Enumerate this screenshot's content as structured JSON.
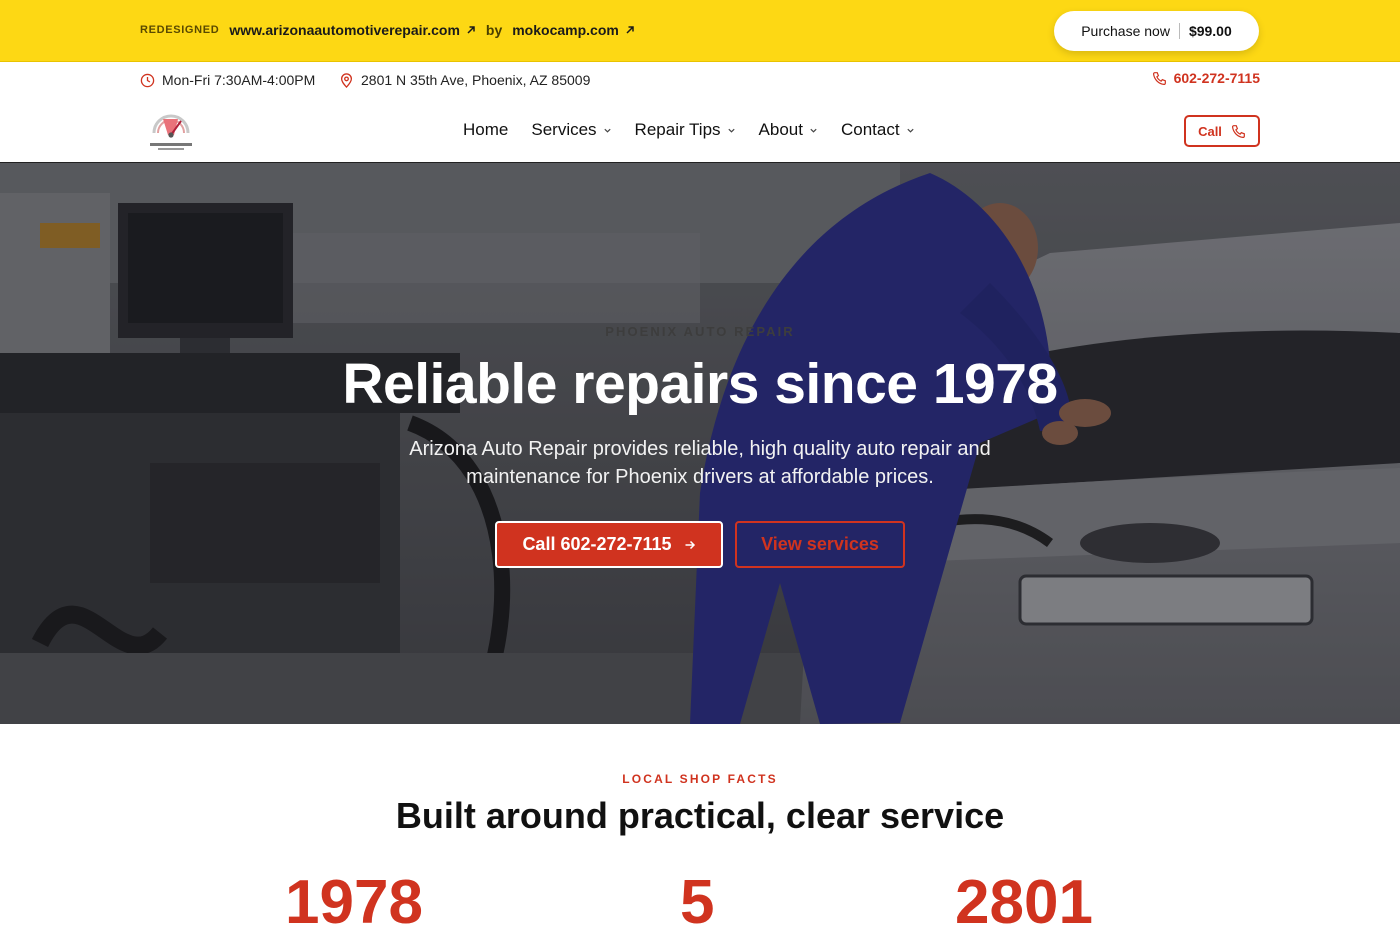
{
  "promo": {
    "tag": "REDESIGNED",
    "site_link": "www.arizonaautomotiverepair.com",
    "by": "by",
    "author_link": "mokocamp.com",
    "purchase_label": "Purchase now",
    "purchase_price": "$99.00"
  },
  "infobar": {
    "hours": "Mon-Fri 7:30AM-4:00PM",
    "address": "2801 N 35th Ave, Phoenix, AZ 85009",
    "phone": "602-272-7115"
  },
  "nav": {
    "items": [
      {
        "label": "Home",
        "dropdown": false
      },
      {
        "label": "Services",
        "dropdown": true
      },
      {
        "label": "Repair Tips",
        "dropdown": true
      },
      {
        "label": "About",
        "dropdown": true
      },
      {
        "label": "Contact",
        "dropdown": true
      }
    ],
    "call_label": "Call"
  },
  "hero": {
    "eyebrow": "PHOENIX AUTO REPAIR",
    "title": "Reliable repairs since 1978",
    "subtitle": "Arizona Auto Repair provides reliable, high quality auto repair and maintenance for Phoenix drivers at affordable prices.",
    "primary_button": "Call 602-272-7115",
    "secondary_button": "View services"
  },
  "facts": {
    "eyebrow": "LOCAL SHOP FACTS",
    "title": "Built around practical, clear service",
    "numbers": [
      "1978",
      "5",
      "2801"
    ]
  },
  "colors": {
    "accent": "#d0331f",
    "promo_bg": "#fdd814"
  }
}
